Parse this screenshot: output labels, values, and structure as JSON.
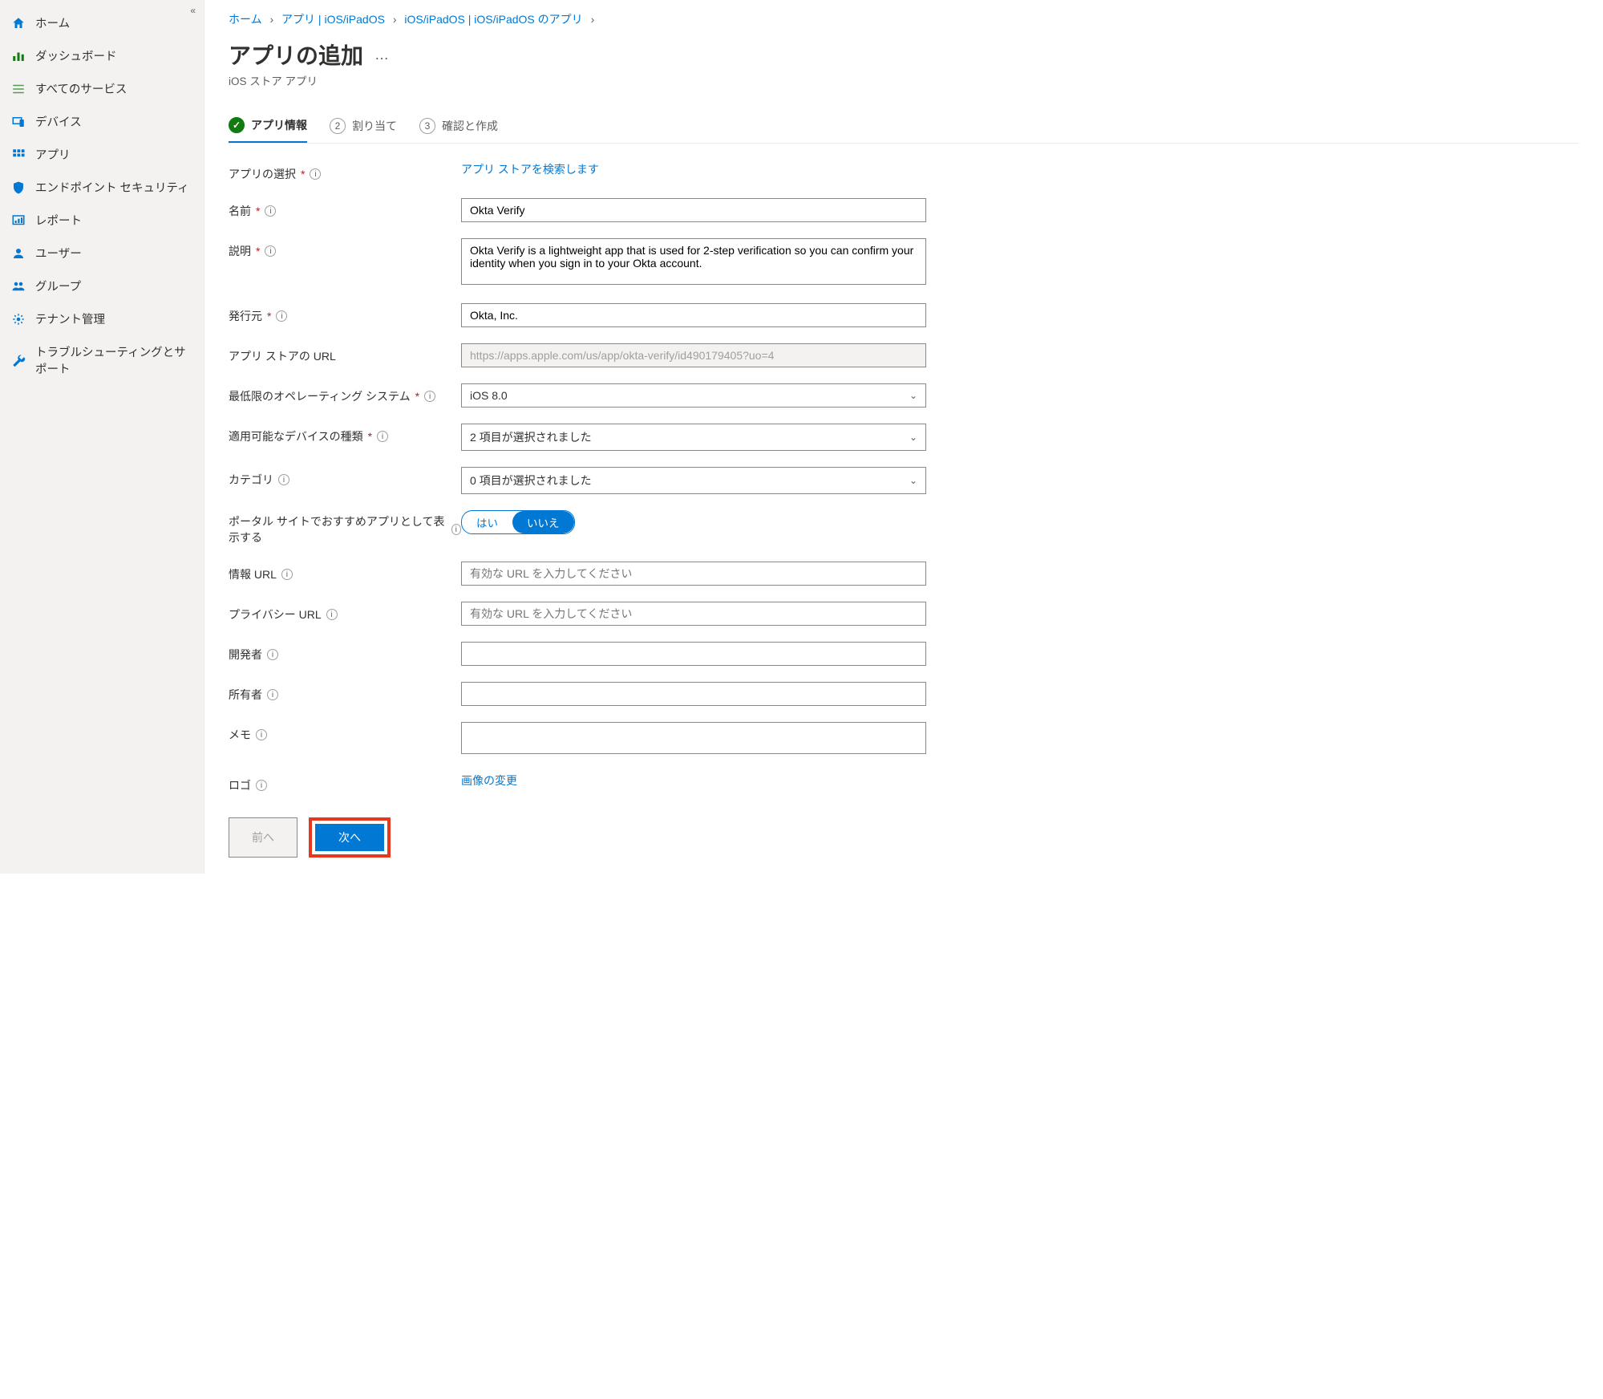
{
  "sidebar": {
    "items": [
      {
        "label": "ホーム",
        "icon": "home"
      },
      {
        "label": "ダッシュボード",
        "icon": "dashboard"
      },
      {
        "label": "すべてのサービス",
        "icon": "list"
      },
      {
        "label": "デバイス",
        "icon": "devices"
      },
      {
        "label": "アプリ",
        "icon": "apps"
      },
      {
        "label": "エンドポイント セキュリティ",
        "icon": "shield"
      },
      {
        "label": "レポート",
        "icon": "report"
      },
      {
        "label": "ユーザー",
        "icon": "user"
      },
      {
        "label": "グループ",
        "icon": "group"
      },
      {
        "label": "テナント管理",
        "icon": "tenant"
      },
      {
        "label": "トラブルシューティングとサポート",
        "icon": "wrench"
      }
    ]
  },
  "breadcrumb": [
    "ホーム",
    "アプリ | iOS/iPadOS",
    "iOS/iPadOS | iOS/iPadOS のアプリ"
  ],
  "header": {
    "title": "アプリの追加",
    "subtitle": "iOS ストア アプリ"
  },
  "stepper": {
    "step1": "アプリ情報",
    "step2": "割り当て",
    "step3": "確認と作成"
  },
  "form": {
    "select_app_label": "アプリの選択",
    "search_store_link": "アプリ ストアを検索します",
    "name_label": "名前",
    "name_value": "Okta Verify",
    "desc_label": "説明",
    "desc_value": "Okta Verify is a lightweight app that is used for 2-step verification so you can confirm your identity when you sign in to your Okta account.",
    "publisher_label": "発行元",
    "publisher_value": "Okta, Inc.",
    "appstore_url_label": "アプリ ストアの URL",
    "appstore_url_value": "https://apps.apple.com/us/app/okta-verify/id490179405?uo=4",
    "min_os_label": "最低限のオペレーティング システム",
    "min_os_value": "iOS 8.0",
    "device_type_label": "適用可能なデバイスの種類",
    "device_type_value": "2 項目が選択されました",
    "category_label": "カテゴリ",
    "category_value": "0 項目が選択されました",
    "featured_label": "ポータル サイトでおすすめアプリとして表示する",
    "featured_yes": "はい",
    "featured_no": "いいえ",
    "info_url_label": "情報 URL",
    "url_placeholder": "有効な URL を入力してください",
    "privacy_url_label": "プライバシー URL",
    "developer_label": "開発者",
    "owner_label": "所有者",
    "notes_label": "メモ",
    "logo_label": "ロゴ",
    "change_image_link": "画像の変更"
  },
  "footer": {
    "prev": "前へ",
    "next": "次へ"
  }
}
